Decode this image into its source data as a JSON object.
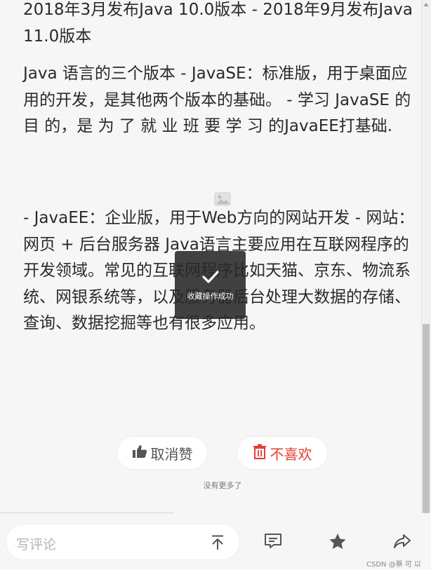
{
  "article": {
    "p1": "2018年3月发布Java 10.0版本 - 2018年9月发布Java 11.0版本",
    "p2": "Java 语言的三个版本 - JavaSE：标准版，用于桌面应用的开发，是其他两个版本的基础。 - 学习 JavaSE 的 目 的，是 为 了 就 业 班 要 学 习 的JavaEE打基础.",
    "p3": "- JavaEE：企业版，用于Web方向的网站开发 - 网站：网页 + 后台服务器 Java语言主要应用在互联网程序的开发领域。常见的互联网程序比如天猫、京东、物流系统、网银系统等，以及服务器后台处理大数据的存储、查询、数据挖掘等也有很多应用。"
  },
  "toast": {
    "message": "收藏操作成功"
  },
  "actions": {
    "like_label": "取消赞",
    "dislike_label": "不喜欢",
    "no_more": "没有更多了"
  },
  "bottom_bar": {
    "comment_placeholder": "写评论",
    "icons": [
      "top-arrow-icon",
      "comment-icon",
      "star-icon",
      "share-icon"
    ]
  },
  "watermark": "CSDN @蔡 可 以",
  "colors": {
    "dislike": "#e33e33",
    "toast_bg": "#282828"
  }
}
